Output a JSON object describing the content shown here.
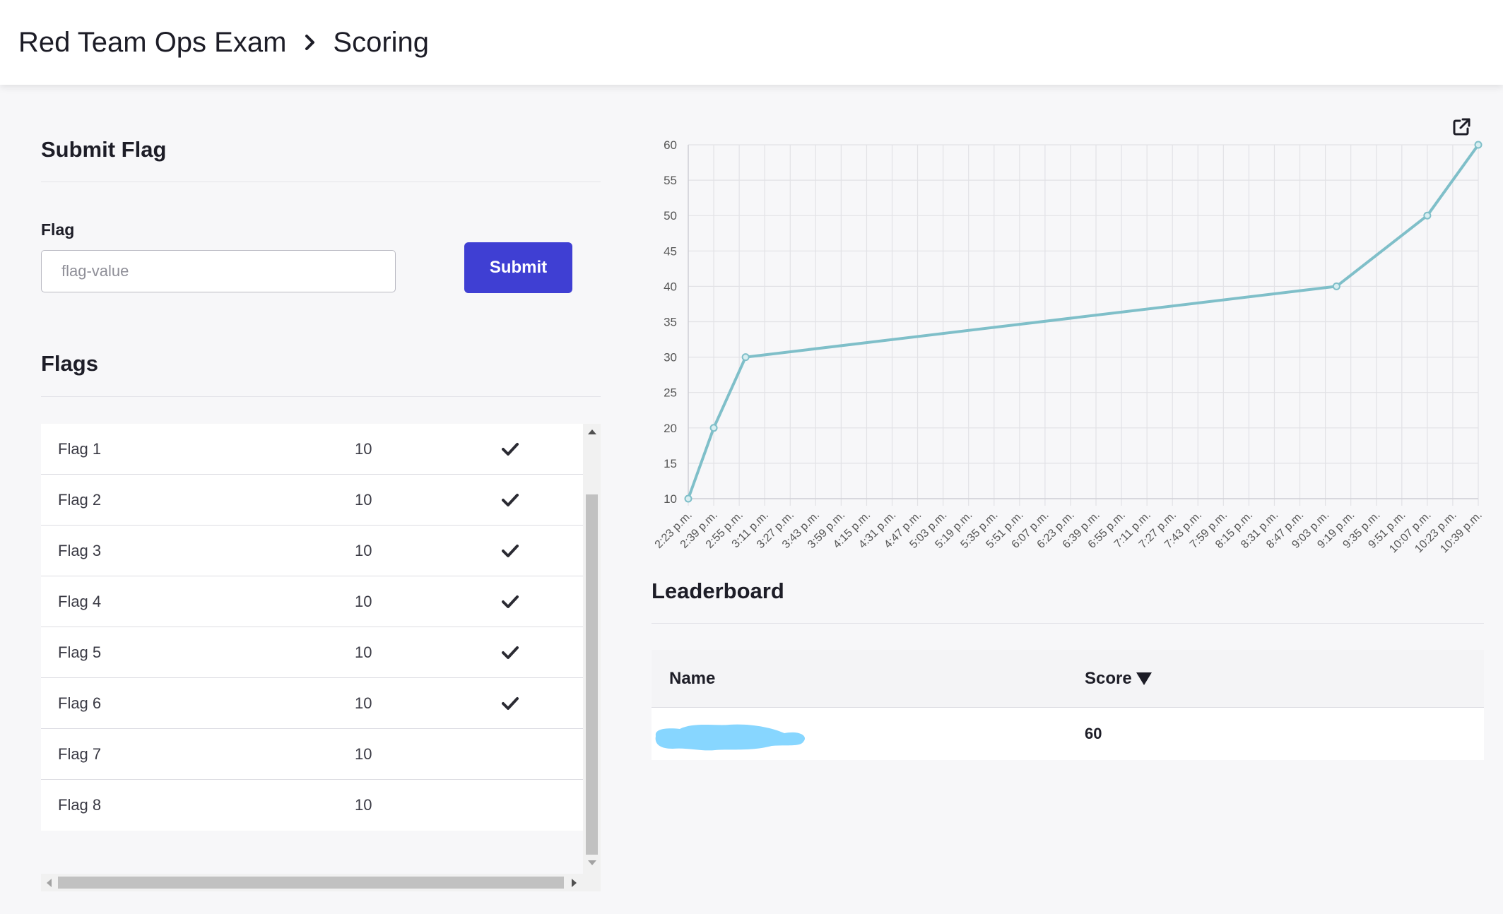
{
  "breadcrumb": {
    "parent": "Red Team Ops Exam",
    "current": "Scoring"
  },
  "submit": {
    "title": "Submit Flag",
    "field_label": "Flag",
    "placeholder": "flag-value",
    "value": "",
    "button_label": "Submit"
  },
  "flags": {
    "title": "Flags",
    "rows": [
      {
        "name": "Flag 1",
        "points": "10",
        "solved": true
      },
      {
        "name": "Flag 2",
        "points": "10",
        "solved": true
      },
      {
        "name": "Flag 3",
        "points": "10",
        "solved": true
      },
      {
        "name": "Flag 4",
        "points": "10",
        "solved": true
      },
      {
        "name": "Flag 5",
        "points": "10",
        "solved": true
      },
      {
        "name": "Flag 6",
        "points": "10",
        "solved": true
      },
      {
        "name": "Flag 7",
        "points": "10",
        "solved": false
      },
      {
        "name": "Flag 8",
        "points": "10",
        "solved": false
      }
    ]
  },
  "leaderboard": {
    "title": "Leaderboard",
    "headers": {
      "name": "Name",
      "score": "Score"
    },
    "rows": [
      {
        "name": "",
        "name_redacted": true,
        "score": "60"
      }
    ]
  },
  "icons": {
    "breadcrumb_separator": "chevron-right-icon",
    "solved": "checkmark-icon",
    "popout": "external-link-icon",
    "sort": "sort-desc-icon"
  },
  "colors": {
    "accent": "#3f3fd3",
    "line": "#7fbfc9",
    "redaction": "#87d6ff"
  },
  "chart_data": {
    "type": "line",
    "categories": [
      "2:23 p.m.",
      "2:39 p.m.",
      "2:55 p.m.",
      "3:11 p.m.",
      "3:27 p.m.",
      "3:43 p.m.",
      "3:59 p.m.",
      "4:15 p.m.",
      "4:31 p.m.",
      "4:47 p.m.",
      "5:03 p.m.",
      "5:19 p.m.",
      "5:35 p.m.",
      "5:51 p.m.",
      "6:07 p.m.",
      "6:23 p.m.",
      "6:39 p.m.",
      "6:55 p.m.",
      "7:11 p.m.",
      "7:27 p.m.",
      "7:43 p.m.",
      "7:59 p.m.",
      "8:15 p.m.",
      "8:31 p.m.",
      "8:47 p.m.",
      "9:03 p.m.",
      "9:19 p.m.",
      "9:35 p.m.",
      "9:51 p.m.",
      "10:07 p.m.",
      "10:23 p.m.",
      "10:39 p.m."
    ],
    "series": [
      {
        "x": [
          "2:23 p.m.",
          "2:39 p.m.",
          "2:59 p.m.",
          "9:10 p.m.",
          "10:07 p.m.",
          "10:39 p.m."
        ],
        "values": [
          10,
          20,
          30,
          40,
          50,
          60
        ]
      }
    ],
    "yticks": [
      10,
      15,
      20,
      25,
      30,
      35,
      40,
      45,
      50,
      55,
      60
    ],
    "ylim": [
      10,
      60
    ],
    "grid": true,
    "legend": "none"
  }
}
